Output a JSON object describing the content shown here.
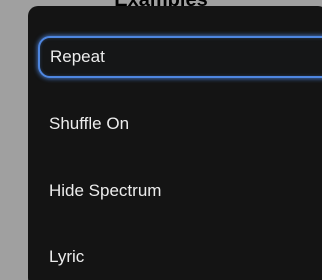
{
  "caption": "Examples",
  "menu": {
    "items": [
      {
        "label": "Repeat",
        "focused": true
      },
      {
        "label": "Shuffle On",
        "focused": false
      },
      {
        "label": "Hide Spectrum",
        "focused": false
      },
      {
        "label": "Lyric",
        "focused": false
      }
    ],
    "focus_color": "#4e86e0",
    "background_color": "#141414",
    "text_color": "#ececec"
  }
}
